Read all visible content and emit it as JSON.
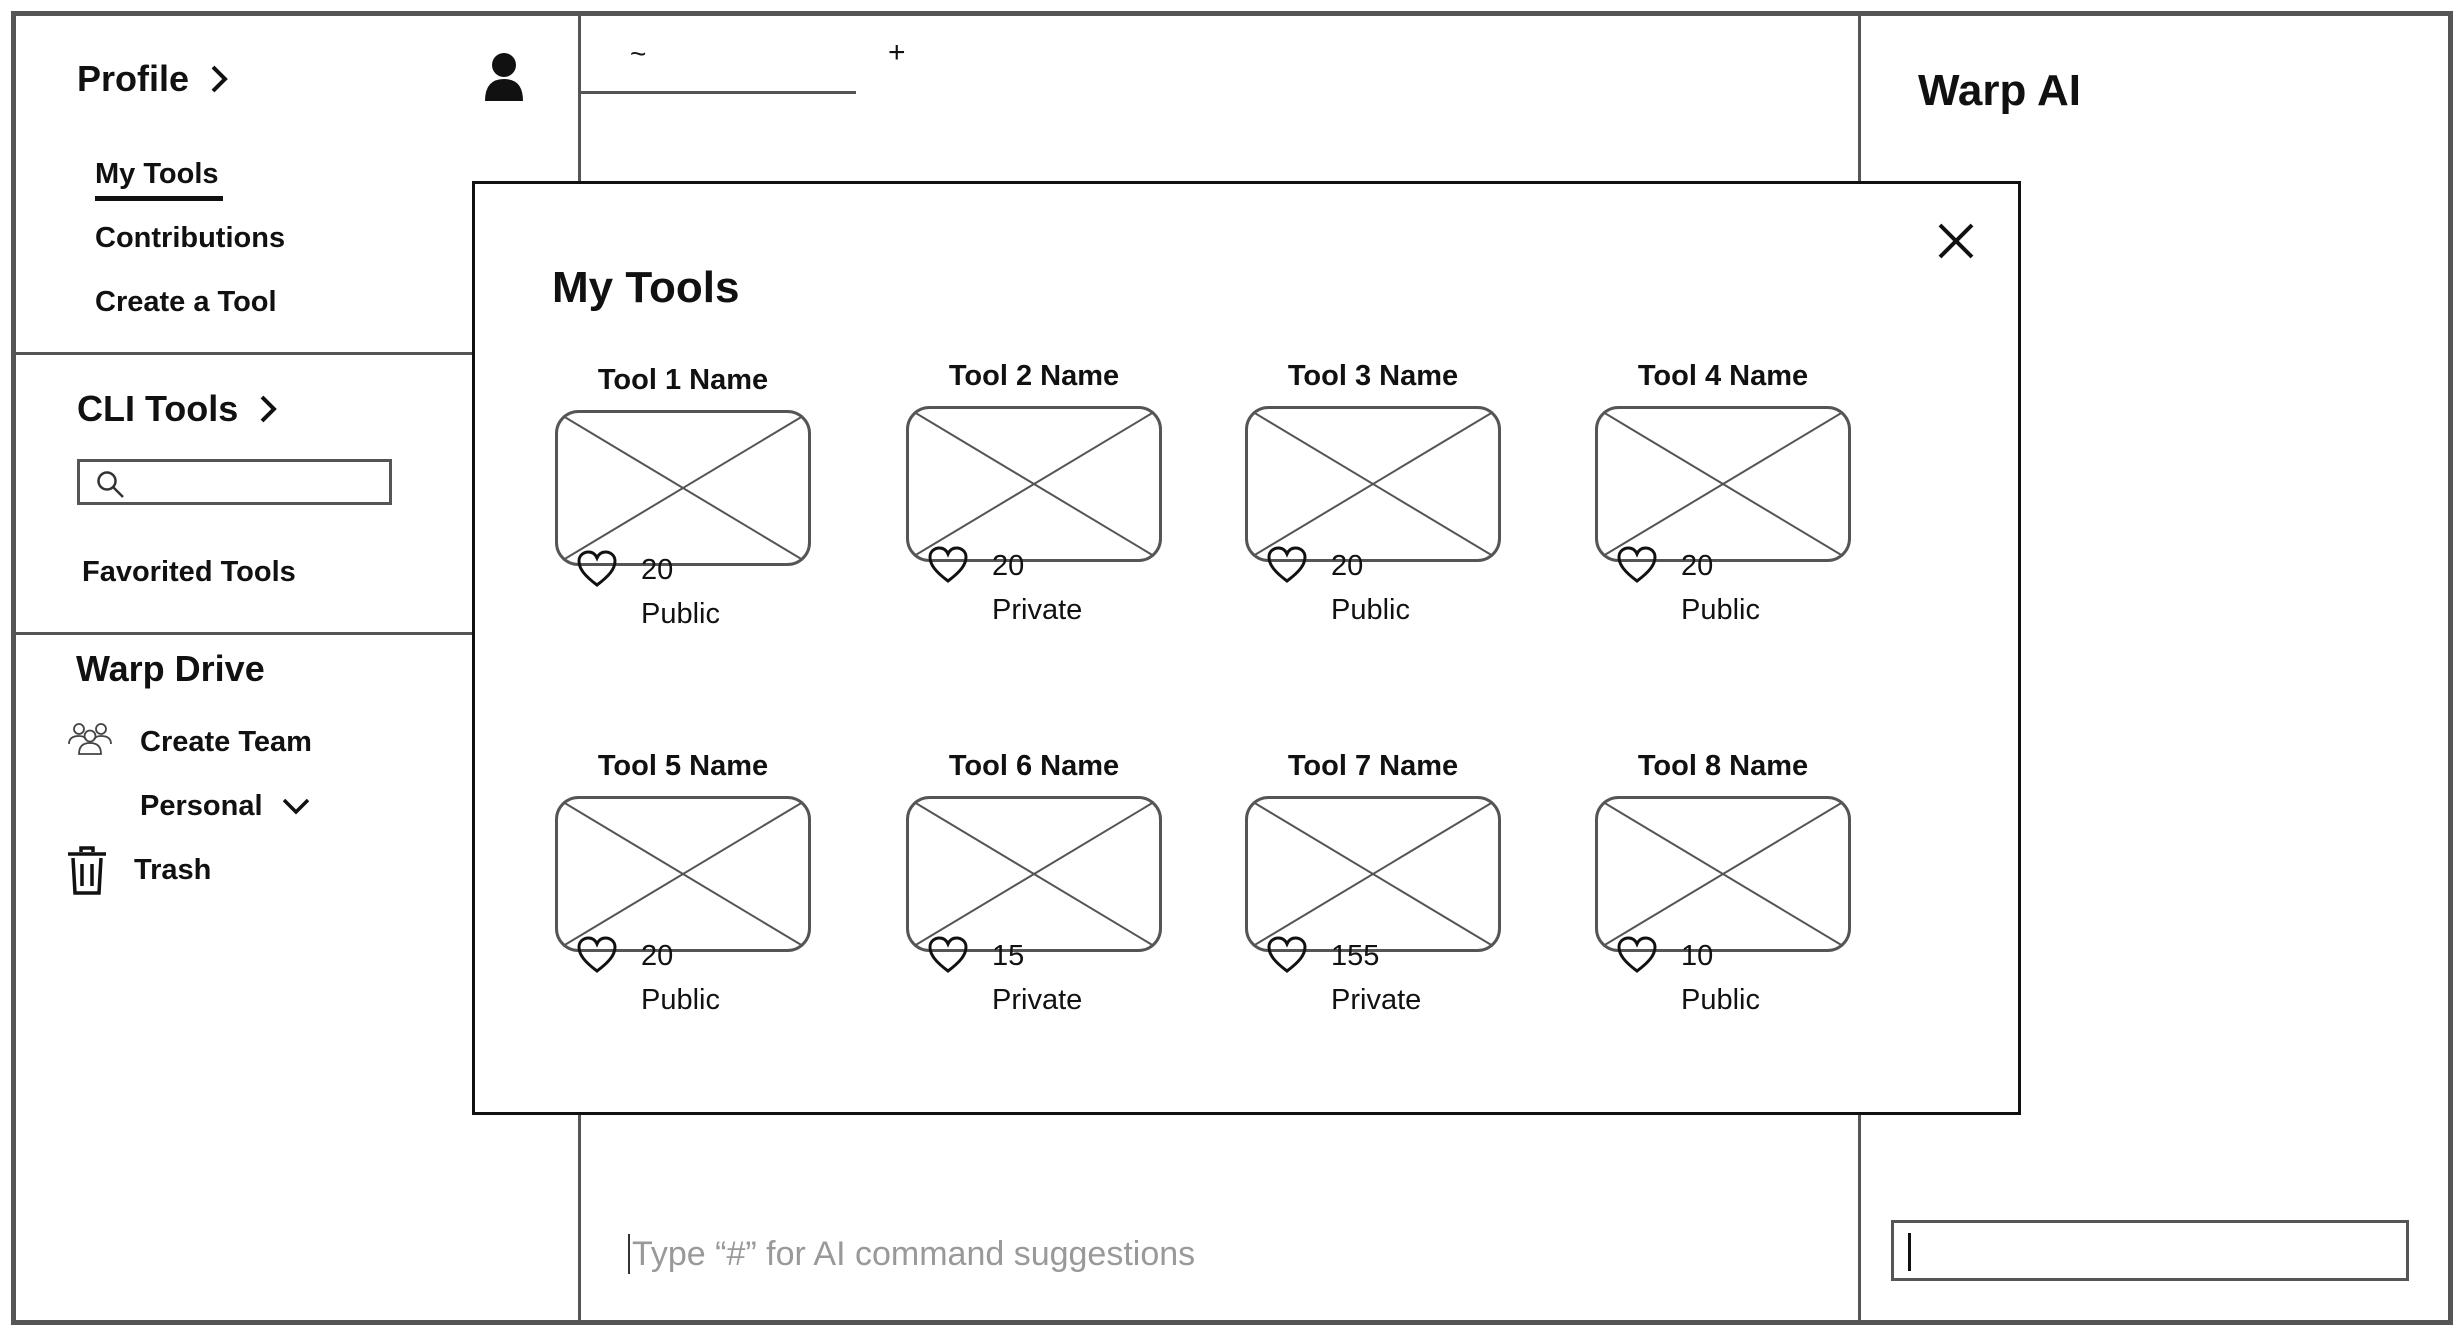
{
  "sidebar": {
    "profile": {
      "title": "Profile",
      "links": [
        "My Tools",
        "Contributions",
        "Create a Tool"
      ]
    },
    "cli_tools": {
      "title": "CLI Tools",
      "search_value": "",
      "favorited": "Favorited Tools"
    },
    "warp_drive": {
      "title": "Warp Drive",
      "create_team": "Create Team",
      "personal": "Personal",
      "trash": "Trash"
    }
  },
  "tabs": {
    "active_label": "~",
    "add_label": "+"
  },
  "terminal": {
    "placeholder": "Type “#” for AI command suggestions"
  },
  "ai_panel": {
    "title": "Warp AI",
    "input_value": ""
  },
  "modal": {
    "title": "My Tools",
    "tools": [
      {
        "name": "Tool 1 Name",
        "likes": "20",
        "visibility": "Public"
      },
      {
        "name": "Tool 2 Name",
        "likes": "20",
        "visibility": "Private"
      },
      {
        "name": "Tool 3 Name",
        "likes": "20",
        "visibility": "Public"
      },
      {
        "name": "Tool 4 Name",
        "likes": "20",
        "visibility": "Public"
      },
      {
        "name": "Tool 5 Name",
        "likes": "20",
        "visibility": "Public"
      },
      {
        "name": "Tool 6 Name",
        "likes": "15",
        "visibility": "Private"
      },
      {
        "name": "Tool 7 Name",
        "likes": "155",
        "visibility": "Private"
      },
      {
        "name": "Tool 8 Name",
        "likes": "10",
        "visibility": "Public"
      }
    ]
  },
  "colors": {
    "border": "#555555",
    "text": "#111111",
    "placeholder": "#999999"
  }
}
